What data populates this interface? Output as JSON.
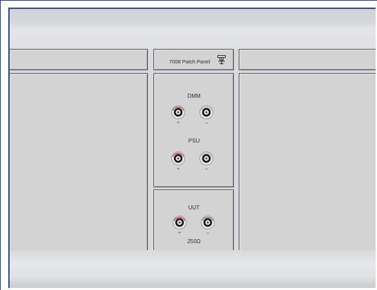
{
  "title_panel": {
    "label": "7008 Patch Panel"
  },
  "logo": {
    "icon": "tektronix-style-logo-icon"
  },
  "dmm": {
    "label": "DMM",
    "positive_label": "+",
    "negative_label": "–",
    "positive_color": "#c84a4a",
    "negative_color": "#bcbcbc"
  },
  "psu": {
    "label": "PSU",
    "positive_label": "+",
    "negative_label": "–",
    "positive_color": "#c84a4a",
    "negative_color": "#bcbcbc"
  },
  "uut": {
    "label": "UUT",
    "resistance": "250Ω",
    "positive_label": "+",
    "negative_label": "–",
    "positive_color": "#c84a4a",
    "negative_color": "#4f9a5b"
  }
}
